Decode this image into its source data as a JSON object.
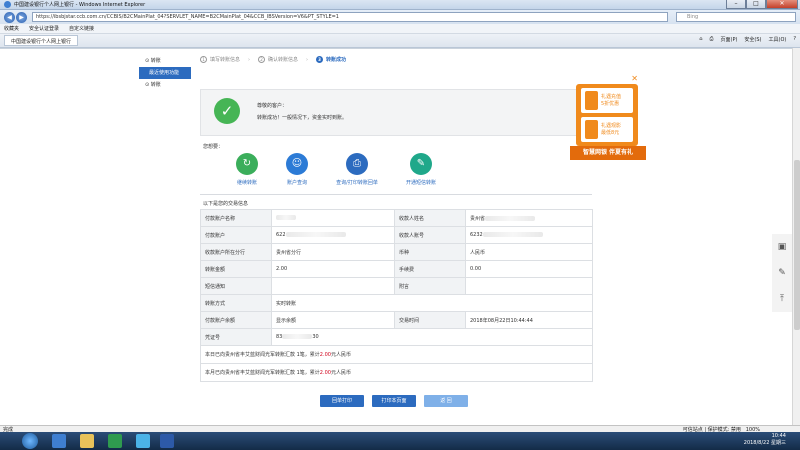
{
  "window": {
    "title": "中国建设银行个人网上银行 - Windows Internet Explorer"
  },
  "address": {
    "url": "https://ibsbjstar.ccb.com.cn/CCBIS/B2CMainPlat_04?SERVLET_NAME=B2CMainPlat_04&CCB_IBSVersion=V6&PT_STYLE=1",
    "search_placeholder": "Bing"
  },
  "favorites": {
    "label": "收藏夹",
    "items": [
      "安全认证登录",
      "自定义链接"
    ]
  },
  "tab": {
    "label": "中国建设银行个人网上银行"
  },
  "commands": [
    "页面(P)",
    "安全(S)",
    "工具(O)"
  ],
  "sidemenu": {
    "items": [
      "转账",
      "最近使用功能",
      "转账"
    ]
  },
  "steps": [
    {
      "num": "1",
      "label": "填写转账信息"
    },
    {
      "num": "2",
      "label": "确认转账信息"
    },
    {
      "num": "3",
      "label": "转账成功"
    }
  ],
  "success": {
    "greeting": "尊敬的客户：",
    "message": "转账成功！一般情况下，资金实时到账。"
  },
  "want_to": "您想要：",
  "actions": [
    {
      "label": "继续转账",
      "color": "#3bae5b"
    },
    {
      "label": "账户查询",
      "color": "#2c7bd6"
    },
    {
      "label": "查询/打印转账回单",
      "color": "#2c6bbf"
    },
    {
      "label": "开通短信转账",
      "color": "#1fa88a"
    }
  ],
  "info_title": "以下是您的交易信息",
  "rows": [
    [
      "付款账户名称",
      "",
      "收款人姓名",
      "贵州省"
    ],
    [
      "付款账户",
      "622",
      "收款人账号",
      "6232"
    ],
    [
      "收款账户所在分行",
      "贵州省分行",
      "币种",
      "人民币"
    ],
    [
      "转账金额",
      "2.00",
      "手续费",
      "0.00"
    ],
    [
      "短信通知",
      "",
      "附言",
      ""
    ],
    [
      "转账方式",
      "实时转账",
      "",
      ""
    ],
    [
      "付款账户余额",
      "显示余额",
      "交易时间",
      "2018年08月22日10:44:44"
    ],
    [
      "凭证号",
      "83",
      "",
      ""
    ]
  ],
  "voucher_tail": "30",
  "notes": {
    "today_prefix": "本日已向贵州省丰艾蓝财闻光军转账汇款 ",
    "today_count": "1笔",
    "today_mid": "，累计",
    "today_amount": "2.00",
    "today_suffix": "元人民币",
    "month_prefix": "本月已向贵州省丰艾蓝财闻光军转账汇款 ",
    "month_count": "1笔",
    "month_mid": "，累计",
    "month_amount": "2.00",
    "month_suffix": "元人民币"
  },
  "buttons": [
    "回单打印",
    "打印本页面",
    "返 回"
  ],
  "ad": {
    "card1": [
      "礼遇充值",
      "5折优惠"
    ],
    "card2": [
      "礼遇观影",
      "最低8元"
    ],
    "ribbon": "智慧网银 伴夏有礼"
  },
  "status": {
    "left": "完成",
    "zone": "可信站点 | 保护模式: 禁用",
    "zoom": "100%"
  },
  "clock": {
    "time": "10:44",
    "date": "2018/8/22 星期三"
  }
}
